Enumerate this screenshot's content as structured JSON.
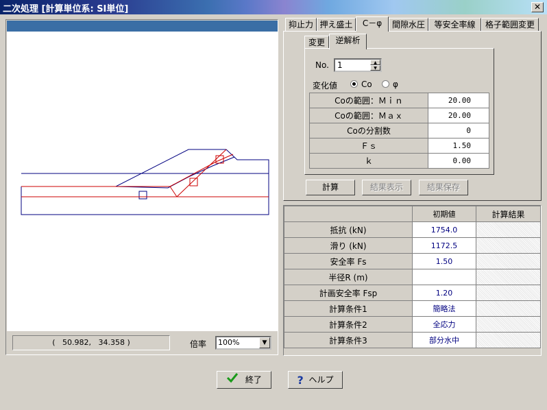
{
  "window": {
    "title": "二次処理 [計算単位系: SI単位]"
  },
  "tabs": [
    "抑止力",
    "押え盛土",
    "C－φ",
    "間隙水圧",
    "等安全率線",
    "格子範囲変更"
  ],
  "active_tab": "C－φ",
  "inner_tabs": [
    "変更",
    "逆解析"
  ],
  "active_inner_tab": "逆解析",
  "form": {
    "no_label": "No.",
    "no_value": "1",
    "variable_label": "変化値",
    "radio_co": "Co",
    "radio_phi": "φ",
    "selected": "Co"
  },
  "params": [
    {
      "label": "Coの範囲：Ｍｉｎ",
      "value": "20.00"
    },
    {
      "label": "Coの範囲：Ｍａｘ",
      "value": "20.00"
    },
    {
      "label": "Coの分割数",
      "value": "0"
    },
    {
      "label": "Ｆｓ",
      "value": "1.50"
    },
    {
      "label": "ｋ",
      "value": "0.00"
    }
  ],
  "buttons": {
    "calc": "計算",
    "show_result": "結果表示",
    "save_result": "結果保存",
    "close": "終了",
    "help": "ヘルプ"
  },
  "results": {
    "headers": [
      "",
      "初期値",
      "計算結果"
    ],
    "rows": [
      {
        "label": "抵抗 (kN)",
        "init": "1754.0",
        "result": ""
      },
      {
        "label": "滑り (kN)",
        "init": "1172.5",
        "result": ""
      },
      {
        "label": "安全率 Fs",
        "init": "1.50",
        "result": ""
      },
      {
        "label": "半径R (m)",
        "init": "",
        "result": ""
      },
      {
        "label": "計画安全率 Fsp",
        "init": "1.20",
        "result": ""
      },
      {
        "label": "計算条件1",
        "init": "簡略法",
        "result": ""
      },
      {
        "label": "計算条件2",
        "init": "全応力",
        "result": ""
      },
      {
        "label": "計算条件3",
        "init": "部分水中",
        "result": ""
      }
    ]
  },
  "canvas": {
    "coordinate": "(   50.982,   34.358 )",
    "zoom_label": "倍率",
    "zoom_value": "100%"
  },
  "colors": {
    "header_blue": "#3a6ea5",
    "section_line": "#000080",
    "slip_line": "#cc0000"
  }
}
